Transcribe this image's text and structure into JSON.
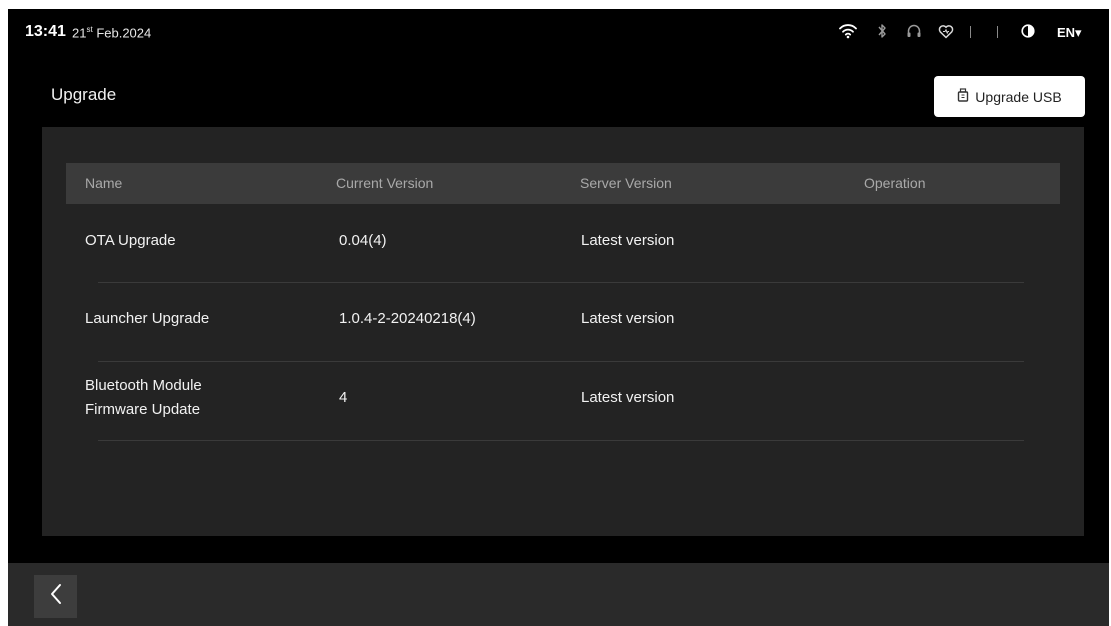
{
  "status_bar": {
    "time": "13:41",
    "date_day": "21",
    "date_suffix": "st",
    "date_rest": " Feb.2024",
    "language": "EN▾",
    "icons": [
      "wifi-icon",
      "bluetooth-icon",
      "headset-icon",
      "heart-icon",
      "contrast-icon"
    ]
  },
  "header": {
    "title": "Upgrade",
    "usb_button_label": "Upgrade USB",
    "usb_button_icon": "usb-drive-icon"
  },
  "table": {
    "columns": [
      "Name",
      "Current Version",
      "Server Version",
      "Operation"
    ],
    "rows": [
      {
        "name": "OTA Upgrade",
        "name_line2": "",
        "current": "0.04(4)",
        "server": "Latest version",
        "operation": ""
      },
      {
        "name": "Launcher Upgrade",
        "name_line2": "",
        "current": "1.0.4-2-20240218(4)",
        "server": "Latest version",
        "operation": ""
      },
      {
        "name": "Bluetooth Module",
        "name_line2": "Firmware Update",
        "current": "4",
        "server": "Latest version",
        "operation": ""
      }
    ]
  },
  "bottom_bar": {
    "back_icon": "chevron-left-icon"
  },
  "colors": {
    "screen_bg": "#000000",
    "panel_bg": "#232323",
    "table_header_bg": "#3b3b3b",
    "bottom_bar_bg": "#2a2a2a",
    "button_bg": "#ffffff"
  }
}
